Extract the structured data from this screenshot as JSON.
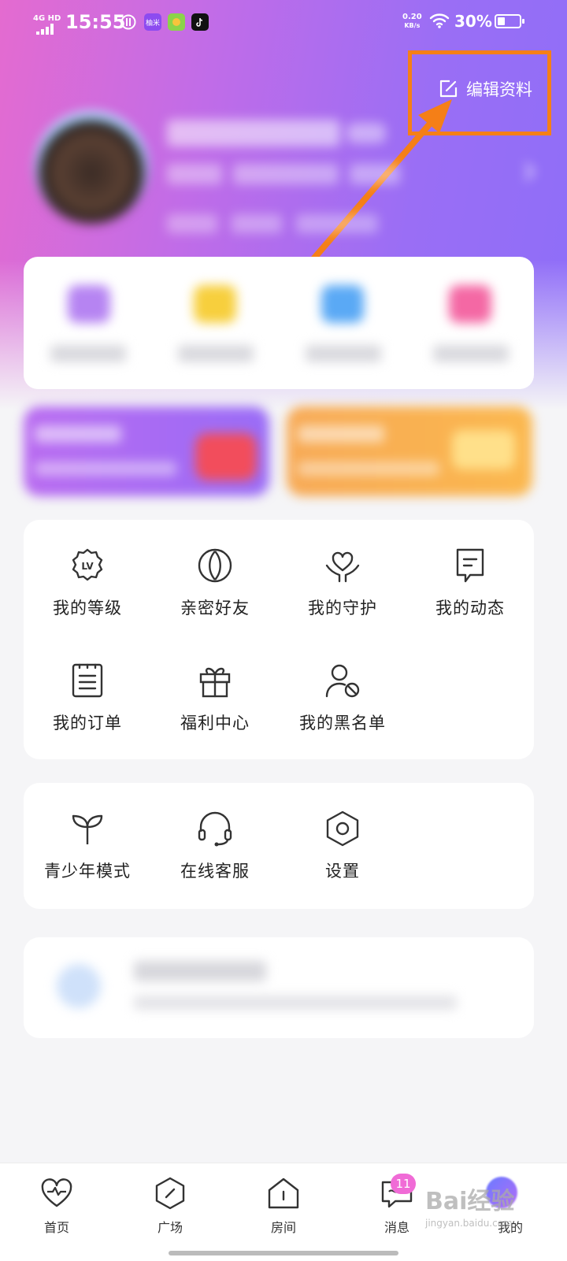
{
  "status_bar": {
    "network": "4G HD",
    "time": "15:55",
    "apps": [
      "柚米"
    ],
    "speed_value": "0.20",
    "speed_unit": "KB/s",
    "battery_percent": "30%",
    "battery_level": 0.3
  },
  "header": {
    "edit_profile": "编辑资料"
  },
  "features": [
    {
      "icon": "level-badge-icon",
      "label": "我的等级"
    },
    {
      "icon": "intimate-friends-icon",
      "label": "亲密好友"
    },
    {
      "icon": "guardian-heart-icon",
      "label": "我的守护"
    },
    {
      "icon": "message-square-icon",
      "label": "我的动态"
    },
    {
      "icon": "order-list-icon",
      "label": "我的订单"
    },
    {
      "icon": "gift-icon",
      "label": "福利中心"
    },
    {
      "icon": "blocked-user-icon",
      "label": "我的黑名单"
    }
  ],
  "settings": [
    {
      "icon": "sprout-icon",
      "label": "青少年模式"
    },
    {
      "icon": "headset-icon",
      "label": "在线客服"
    },
    {
      "icon": "settings-hexagon-icon",
      "label": "设置"
    }
  ],
  "tabbar": {
    "tabs": [
      {
        "icon": "heartbeat-icon",
        "label": "首页"
      },
      {
        "icon": "compass-icon",
        "label": "广场"
      },
      {
        "icon": "house-icon",
        "label": "房间"
      },
      {
        "icon": "chat-icon",
        "label": "消息"
      },
      {
        "icon": "avatar-icon",
        "label": "我的"
      }
    ],
    "messages_badge": "11"
  },
  "watermark": {
    "text": "Bai经验",
    "url": "jingyan.baidu.com"
  },
  "colors": {
    "header_gradient_start": "#e46bd0",
    "header_gradient_end": "#8e6ef8",
    "highlight": "#f57f17",
    "badge": "#f06bd6"
  }
}
